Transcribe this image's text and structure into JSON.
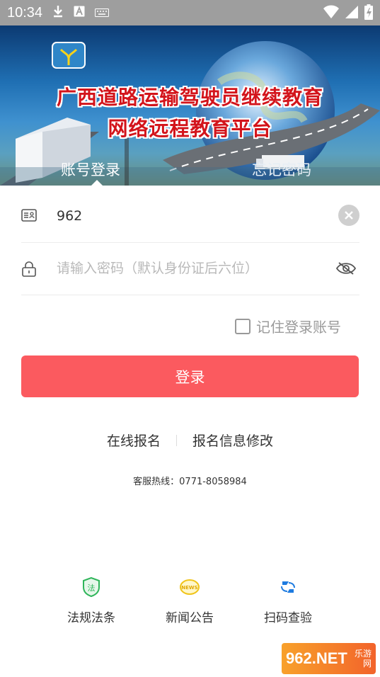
{
  "status_bar": {
    "time": "10:34"
  },
  "banner": {
    "title_line1": "广西道路运输驾驶员继续教育",
    "title_line2": "网络远程教育平台",
    "tabs": [
      {
        "label": "账号登录",
        "active": true
      },
      {
        "label": "忘记密码",
        "active": false
      }
    ]
  },
  "form": {
    "account_value": "962",
    "password_placeholder": "请输入密码（默认身份证后六位）",
    "remember_label": "记住登录账号",
    "remember_checked": false,
    "login_label": "登录"
  },
  "links": {
    "register": "在线报名",
    "modify": "报名信息修改"
  },
  "hotline": "客服热线：0771-8058984",
  "bottom_nav": [
    {
      "label": "法规法条",
      "icon": "law-shield-icon"
    },
    {
      "label": "新闻公告",
      "icon": "news-icon"
    },
    {
      "label": "扫码查验",
      "icon": "scan-icon"
    }
  ],
  "watermark": {
    "main": "962.NET",
    "sub": "乐游网"
  },
  "colors": {
    "primary": "#fb5a5f",
    "banner_title": "#d3141b",
    "status_bar": "#9e9e9e"
  }
}
